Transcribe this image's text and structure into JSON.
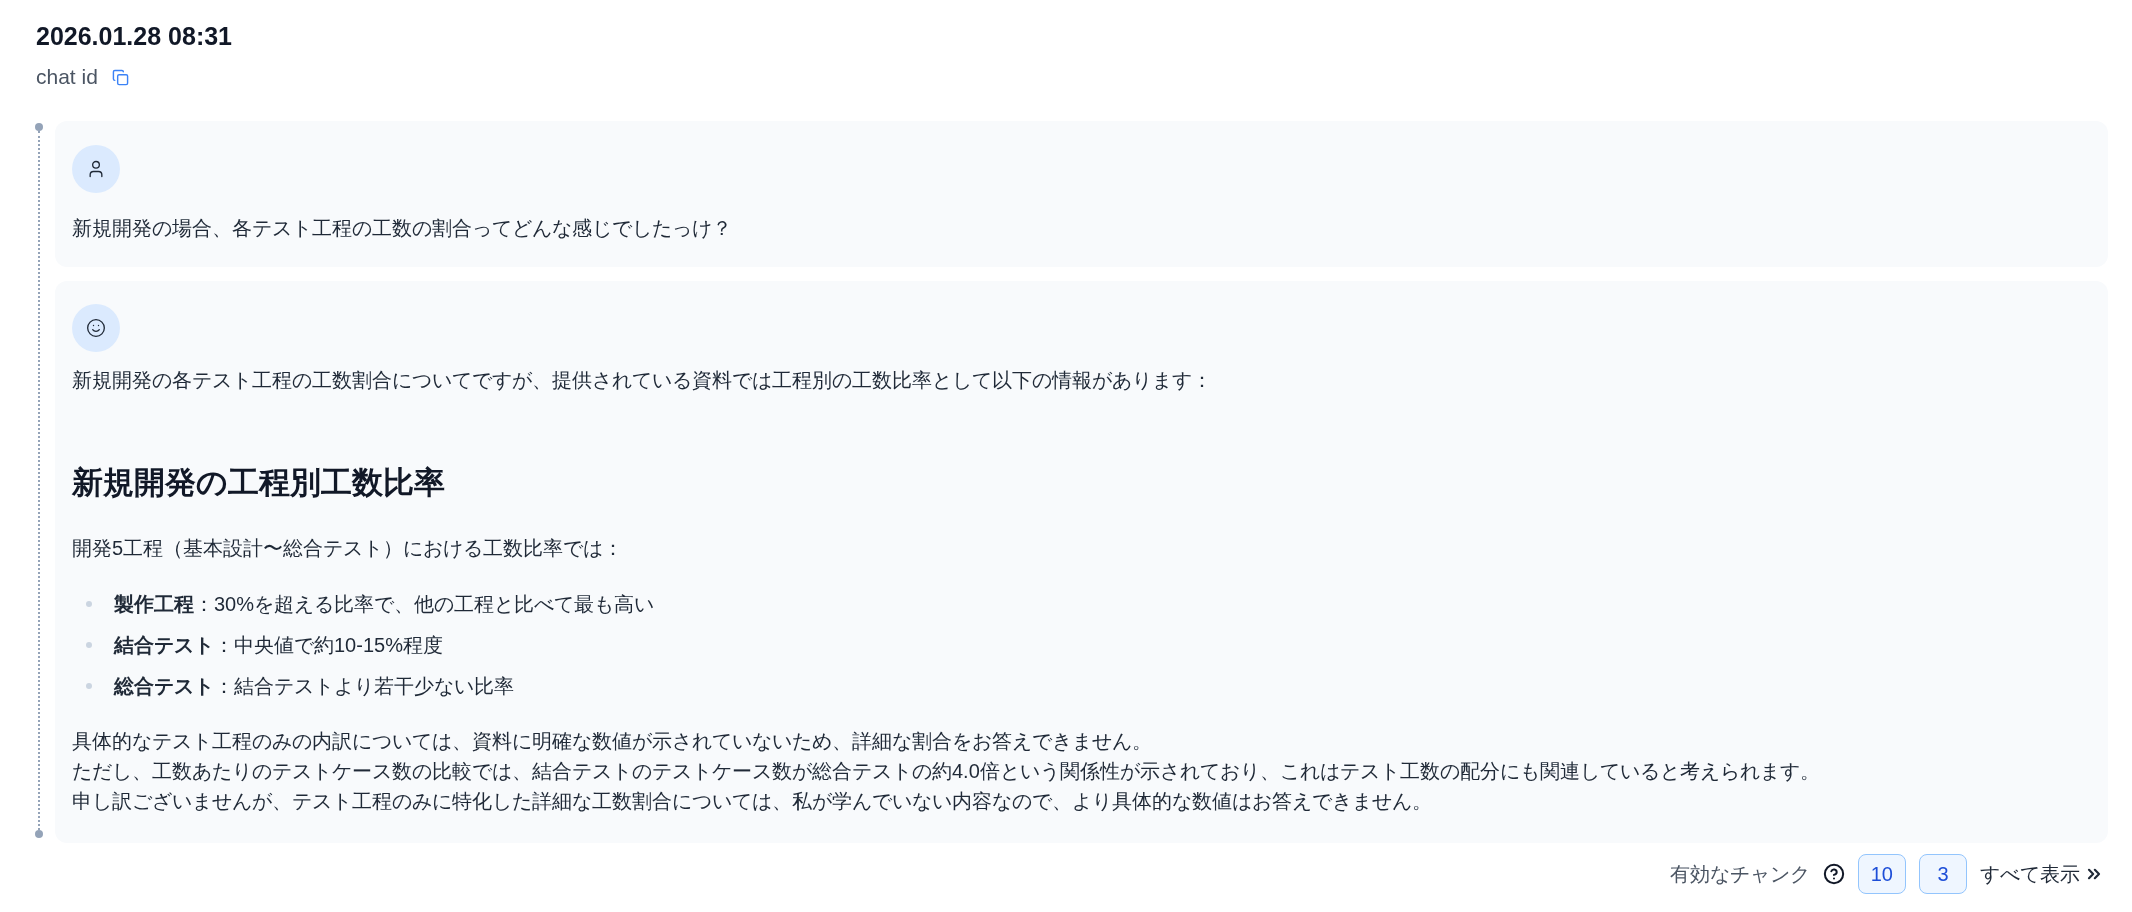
{
  "header": {
    "timestamp": "2026.01.28 08:31",
    "chat_id_label": "chat id"
  },
  "messages": [
    {
      "kind": "user",
      "blocks": [
        {
          "kind": "paragraph",
          "text": "新規開発の場合、各テスト工程の工数の割合ってどんな感じでしたっけ？"
        }
      ]
    },
    {
      "kind": "assistant",
      "blocks": [
        {
          "kind": "paragraph",
          "text": "新規開発の各テスト工程の工数割合についてですが、提供されている資料では工程別の工数比率として以下の情報があります："
        },
        {
          "kind": "heading",
          "text": "新規開発の工程別工数比率"
        },
        {
          "kind": "paragraph",
          "text": "開発5工程（基本設計〜総合テスト）における工数比率では："
        },
        {
          "kind": "list",
          "items": [
            "**製作工程**：30%を超える比率で、他の工程と比べて最も高い",
            "**結合テスト**：中央値で約10-15%程度",
            "**総合テスト**：結合テストより若干少ない比率"
          ]
        },
        {
          "kind": "lines",
          "lines": [
            "具体的なテスト工程のみの内訳については、資料に明確な数値が示されていないため、詳細な割合をお答えできません。",
            "ただし、工数あたりのテストケース数の比較では、結合テストのテストケース数が総合テストの約4.0倍という関係性が示されており、これはテスト工数の配分にも関連していると考えられます。",
            "申し訳ございませんが、テスト工程のみに特化した詳細な工数割合については、私が学んでいない内容なので、より具体的な数値はお答えできません。"
          ]
        }
      ]
    }
  ],
  "footer": {
    "label": "有効なチャンク",
    "chunks": [
      "10",
      "3"
    ],
    "show_all": "すべて表示"
  }
}
